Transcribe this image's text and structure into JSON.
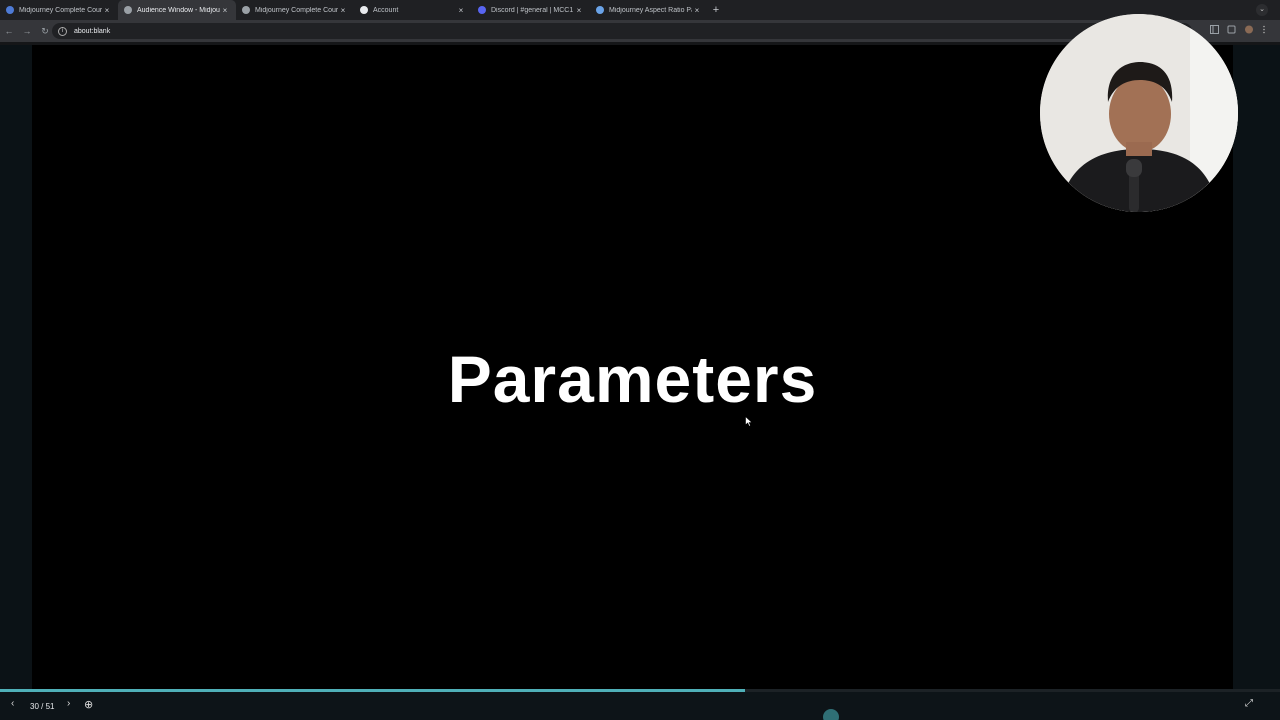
{
  "browser": {
    "tabs": [
      {
        "title": "Midjourney Complete Course",
        "favicon_color": "#4e7bd6",
        "active": false
      },
      {
        "title": "Audience Window - Midjourney",
        "favicon_color": "#9aa0a6",
        "active": true
      },
      {
        "title": "Midjourney Complete Course",
        "favicon_color": "#9aa0a6",
        "active": false
      },
      {
        "title": "Account",
        "favicon_color": "#e8eaed",
        "active": false
      },
      {
        "title": "Discord | #general | MCC1",
        "favicon_color": "#5865f2",
        "active": false
      },
      {
        "title": "Midjourney Aspect Ratio Para",
        "favicon_color": "#6aa3e8",
        "active": false
      }
    ],
    "new_tab_label": "+",
    "tab_close_glyph": "×",
    "tab_menu_glyph": "⌄",
    "address": "about:blank",
    "back_glyph": "←",
    "forward_glyph": "→",
    "reload_glyph": "↻",
    "info_glyph": "i",
    "toolbar_icons": [
      "sidebar-icon",
      "extensions-icon",
      "profile-icon",
      "menu-icon"
    ]
  },
  "slide": {
    "title": "Parameters"
  },
  "player": {
    "prev_glyph": "‹",
    "next_glyph": "›",
    "page_counter": "30 / 51",
    "zoom_glyph": "⊕",
    "fullscreen_glyph": "⤢",
    "progress": 0.582
  },
  "colors": {
    "accent": "#4fb0b8",
    "slide_bg": "#000000",
    "chrome_bg": "#35363a"
  }
}
